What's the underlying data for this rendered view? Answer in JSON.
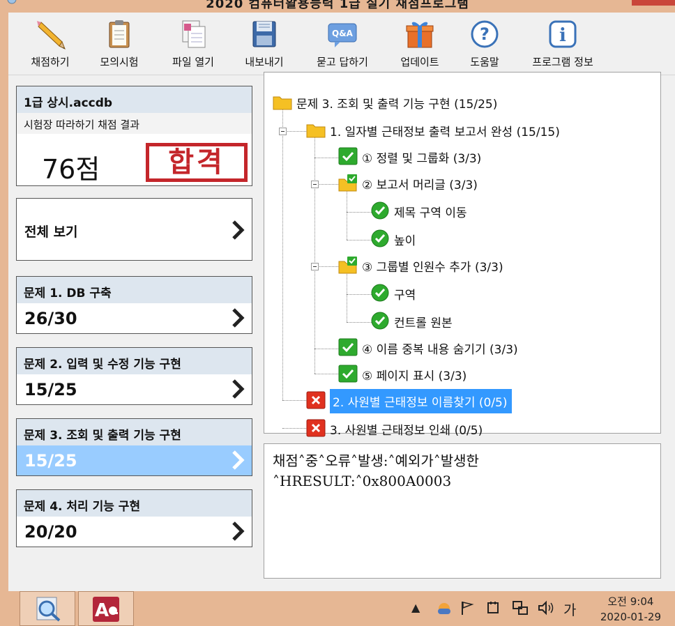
{
  "window": {
    "title": "2020 컴퓨터활용능력 1급 실기 채점프로그램"
  },
  "toolbar": [
    {
      "label": "채점하기",
      "icon": "pencil-icon"
    },
    {
      "label": "모의시험",
      "icon": "clipboard-icon"
    },
    {
      "label": "파일 열기",
      "icon": "open-file-icon"
    },
    {
      "label": "내보내기",
      "icon": "save-disk-icon"
    },
    {
      "label": "묻고 답하기",
      "icon": "qa-icon"
    },
    {
      "label": "업데이트",
      "icon": "gift-icon"
    },
    {
      "label": "도움말",
      "icon": "help-icon"
    },
    {
      "label": "프로그램 정보",
      "icon": "info-icon"
    }
  ],
  "file_card": {
    "filename": "1급 상시.accdb",
    "subtitle": "시험장 따라하기 채점 결과",
    "total_score": "76점",
    "stamp": "합격"
  },
  "all_view": {
    "label": "전체 보기"
  },
  "problems": [
    {
      "title": "문제 1. DB 구축",
      "score": "26/30",
      "active": false
    },
    {
      "title": "문제 2. 입력 및 수정 기능 구현",
      "score": "15/25",
      "active": false
    },
    {
      "title": "문제 3. 조회 및 출력 기능 구현",
      "score": "15/25",
      "active": true
    },
    {
      "title": "문제 4. 처리 기능 구현",
      "score": "20/20",
      "active": false
    }
  ],
  "tree": {
    "root": "문제 3. 조회 및 출력 기능 구현 (15/25)",
    "n1": "1. 일자별 근태정보 출력 보고서 완성 (15/15)",
    "n1_1": "① 정렬 및 그룹화 (3/3)",
    "n1_2": "② 보고서 머리글 (3/3)",
    "n1_2_1": "제목 구역 이동",
    "n1_2_2": "높이",
    "n1_3": "③ 그룹별 인원수 추가 (3/3)",
    "n1_3_1": "구역",
    "n1_3_2": "컨트롤 원본",
    "n1_4": "④ 이름 중복 내용 숨기기 (3/3)",
    "n1_5": "⑤ 페이지 표시 (3/3)",
    "n2": "2. 사원별 근태정보 이름찾기 (0/5)",
    "n3": "3. 사원별 근태정보 인쇄 (0/5)"
  },
  "log": {
    "line1": "채점˄중˄오류˄발생:˄예외가˄발생한",
    "line2": "˄HRESULT:˄0x800A0003"
  },
  "taskbar": {
    "apps": [
      "magnifier-app-icon",
      "access-app-icon"
    ],
    "ime": "가",
    "time": "오전 9:04",
    "date": "2020-01-29"
  },
  "colors": {
    "accent_header": "#dde6ef",
    "active_row": "#99ccff",
    "tree_selection": "#3399ff",
    "pass_stamp": "#c4262b",
    "check_green": "#2eaa2e",
    "fail_red": "#e0311f",
    "taskbar": "#e6b794"
  }
}
